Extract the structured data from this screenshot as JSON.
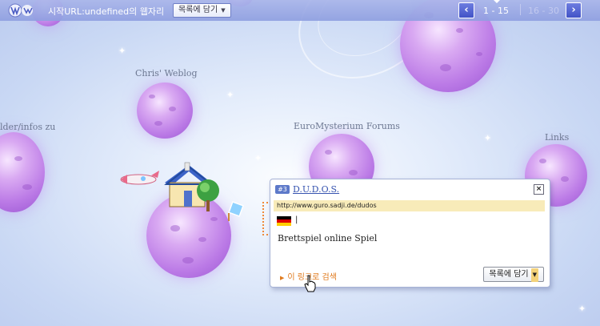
{
  "header": {
    "title": "시작URL:undefined의 웹자리",
    "list_button": "목록에 담기",
    "page_current": "1 - 15",
    "page_next": "16 - 30"
  },
  "planets": {
    "chris": "Chris' Weblog",
    "euro": "EuroMysterium Forums",
    "links": "Links",
    "leftcut": "lder/infos zu"
  },
  "popup": {
    "tag": "#3",
    "title": "D.U.D.O.S.",
    "url": "http://www.guro.sadji.de/dudos",
    "country_sep": "|",
    "description": "Brettspiel online Spiel",
    "search_link": "이 링크로 검색",
    "list_button": "목록에 담기",
    "close": "×"
  },
  "colors": {
    "accent": "#4253c7",
    "planet": "#bb7ae6",
    "link_orange": "#e07a1d",
    "url_bg": "#f8ebb9"
  }
}
